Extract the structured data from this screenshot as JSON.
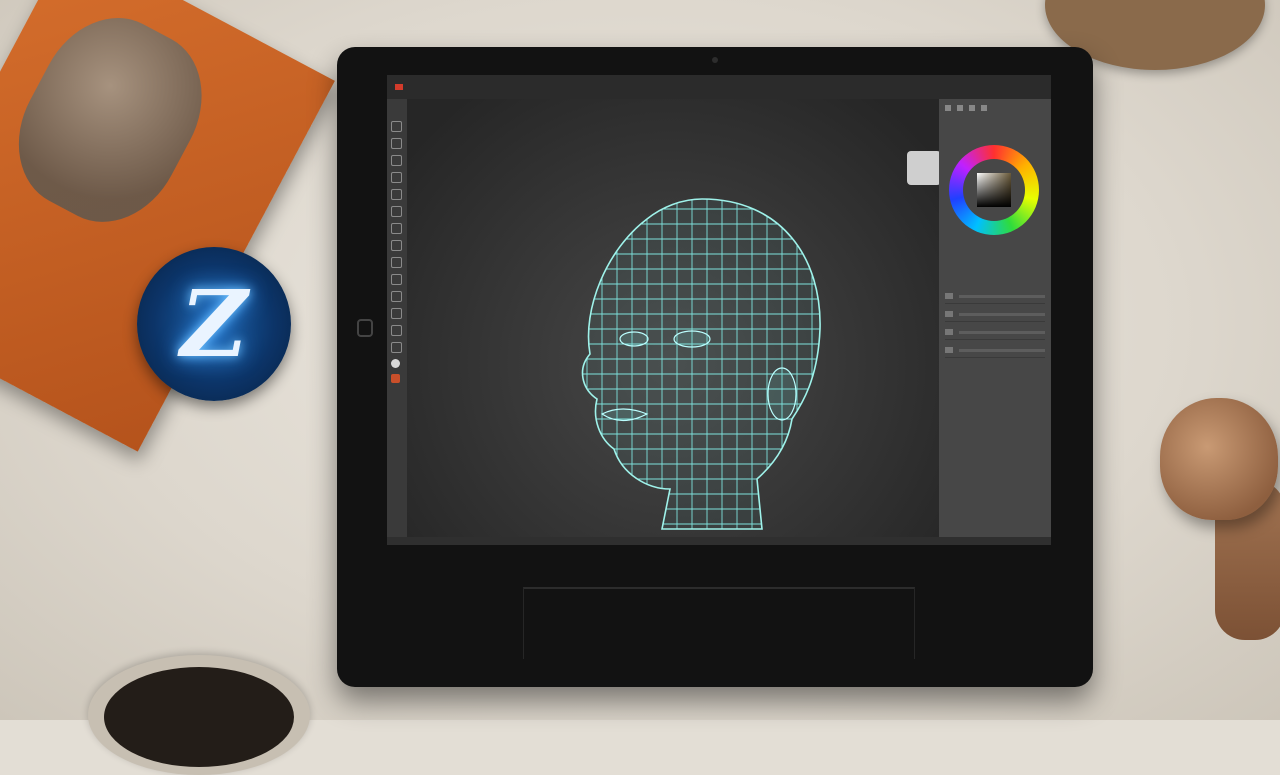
{
  "scene": {
    "badge_letter": "Z",
    "screen": {
      "menu_items": [
        "",
        "",
        "",
        "",
        "",
        "",
        "",
        "",
        ""
      ],
      "document_label": "",
      "panel_title": "",
      "tool_icons": [
        "move-icon",
        "brush-icon",
        "smooth-icon",
        "clay-icon",
        "inflate-icon",
        "pinch-icon",
        "flatten-icon",
        "mask-icon",
        "select-icon",
        "crop-icon",
        "zoom-icon",
        "rotate-icon",
        "scale-icon",
        "pen-icon",
        "material-icon",
        "swatch-icon"
      ]
    },
    "colors": {
      "tablet": "#121212",
      "ui_panel": "#474747",
      "wireframe": "#7fe3dc",
      "badge": "#1b5fa8",
      "book": "#d56e2c"
    }
  }
}
